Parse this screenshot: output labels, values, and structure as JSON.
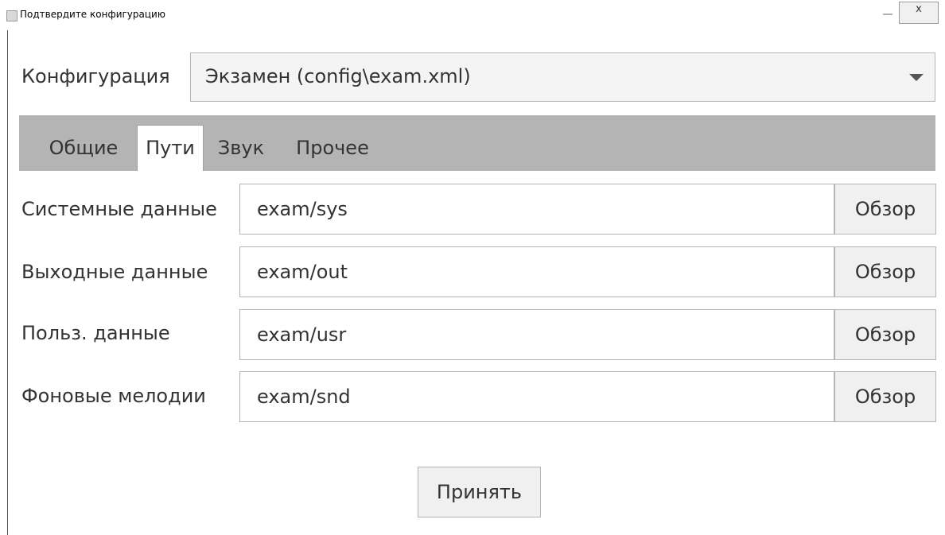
{
  "window": {
    "title": "Подтвердите конфигурацию",
    "close_label": "x"
  },
  "config": {
    "label": "Конфигурация",
    "selected": "Экзамен (config\\exam.xml)"
  },
  "tabs": [
    {
      "label": "Общие",
      "active": false
    },
    {
      "label": "Пути",
      "active": true
    },
    {
      "label": "Звук",
      "active": false
    },
    {
      "label": "Прочее",
      "active": false
    }
  ],
  "paths": [
    {
      "label": "Системные данные",
      "value": "exam/sys",
      "browse": "Обзор"
    },
    {
      "label": "Выходные данные",
      "value": "exam/out",
      "browse": "Обзор"
    },
    {
      "label": "Польз. данные",
      "value": "exam/usr",
      "browse": "Обзор"
    },
    {
      "label": "Фоновые мелодии",
      "value": "exam/snd",
      "browse": "Обзор"
    }
  ],
  "accept_label": "Принять"
}
